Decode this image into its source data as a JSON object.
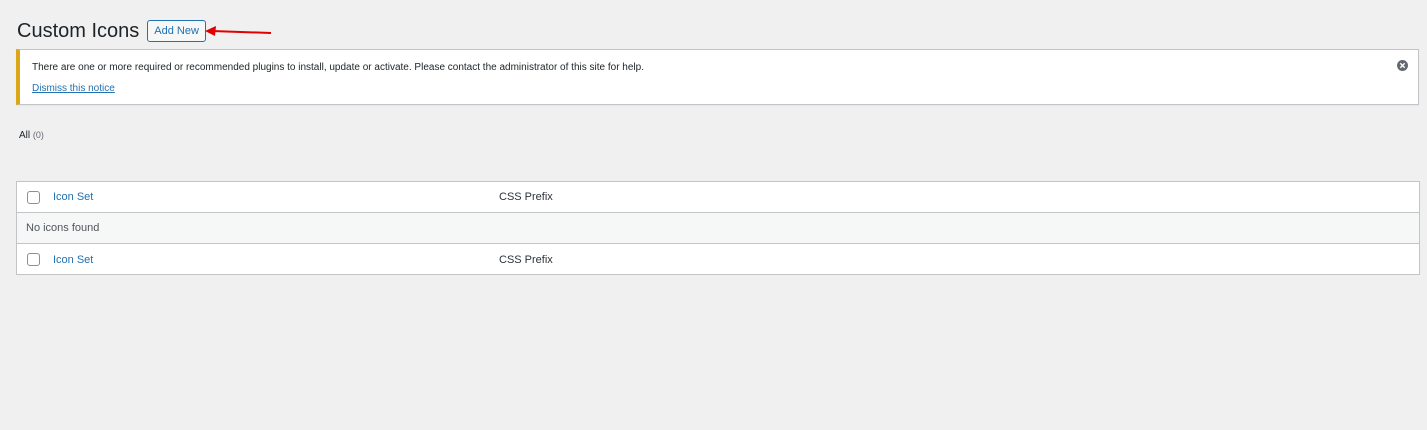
{
  "page": {
    "title": "Custom Icons",
    "add_new_label": "Add New"
  },
  "notice": {
    "message": "There are one or more required or recommended plugins to install, update or activate. Please contact the administrator of this site for help.",
    "dismiss_label": "Dismiss this notice",
    "dismiss_icon": "close-circle-icon",
    "accent_color": "#dba617"
  },
  "filters": {
    "all_label": "All",
    "all_count": "(0)"
  },
  "table": {
    "columns": {
      "name": "Icon Set",
      "prefix": "CSS Prefix"
    },
    "empty_message": "No icons found",
    "footer": {
      "name": "Icon Set",
      "prefix": "CSS Prefix"
    }
  },
  "colors": {
    "background": "#f0f0f1",
    "link": "#2271b1",
    "annotation_arrow": "#e00000"
  }
}
